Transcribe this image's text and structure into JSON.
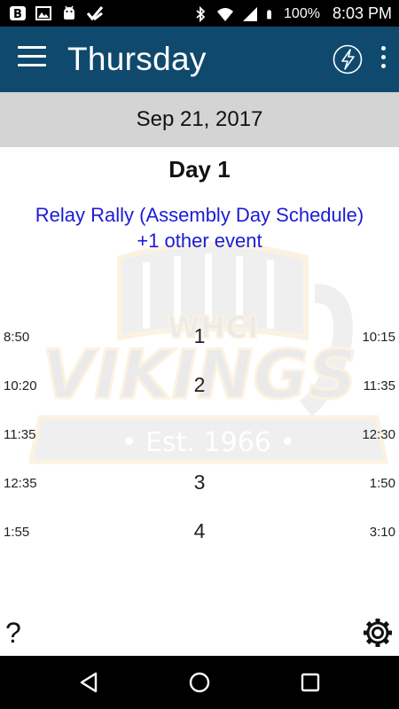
{
  "status_bar": {
    "battery": "100%",
    "time": "8:03 PM",
    "left_icons": [
      "b-icon",
      "image-icon",
      "android-icon",
      "check-send-icon"
    ],
    "right_icons": [
      "bluetooth-icon",
      "wifi-icon",
      "signal-icon",
      "battery-icon"
    ]
  },
  "app_bar": {
    "title": "Thursday",
    "color": "#0f4a6e",
    "menu_icon": "hamburger-icon",
    "bolt_icon": "lightning-circle-icon",
    "overflow_icon": "more-vert-icon"
  },
  "date_bar": {
    "date": "Sep 21, 2017"
  },
  "main": {
    "day": "Day 1",
    "events": [
      "Relay Rally (Assembly Day Schedule)",
      "+1 other event"
    ],
    "event_color": "#1b1bd8",
    "watermark": {
      "text_top": "WHCI",
      "text_main": "VIKINGS",
      "text_banner": "• Est. 1966 •"
    },
    "schedule": [
      {
        "start": "8:50",
        "period": "1",
        "end": "10:15"
      },
      {
        "start": "10:20",
        "period": "2",
        "end": "11:35"
      },
      {
        "start": "11:35",
        "period": "",
        "end": "12:30"
      },
      {
        "start": "12:35",
        "period": "3",
        "end": "1:50"
      },
      {
        "start": "1:55",
        "period": "4",
        "end": "3:10"
      }
    ],
    "help_label": "?",
    "settings_icon": "gear-icon"
  },
  "nav_bar": {
    "icons": [
      "back-icon",
      "home-icon",
      "recents-icon"
    ]
  }
}
